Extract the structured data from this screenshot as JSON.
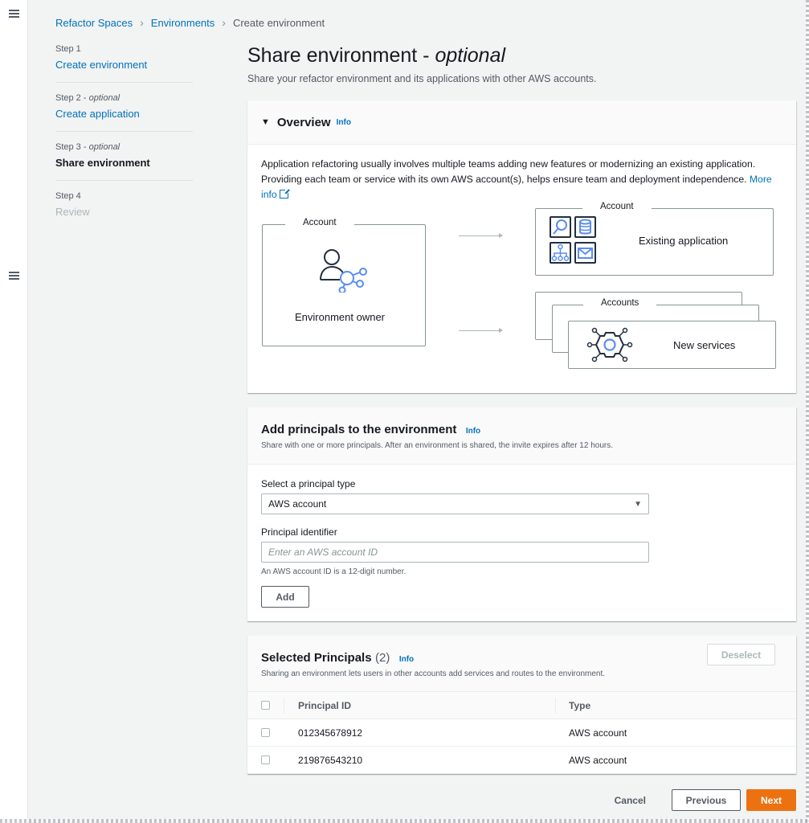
{
  "breadcrumb": [
    {
      "label": "Refactor Spaces",
      "link": true
    },
    {
      "label": "Environments",
      "link": true
    },
    {
      "label": "Create environment",
      "link": false
    }
  ],
  "steps": [
    {
      "number": "Step 1",
      "optional": "",
      "title": "Create environment",
      "state": "link"
    },
    {
      "number": "Step 2",
      "optional": "optional",
      "title": "Create application",
      "state": "link"
    },
    {
      "number": "Step 3",
      "optional": "optional",
      "title": "Share environment",
      "state": "active"
    },
    {
      "number": "Step 4",
      "optional": "",
      "title": "Review",
      "state": "disabled"
    }
  ],
  "page": {
    "title": "Share environment - ",
    "title_optional": "optional",
    "subtitle": "Share your refactor environment and its applications with other AWS accounts."
  },
  "overview": {
    "title": "Overview",
    "info": "Info",
    "text": "Application refactoring usually involves multiple teams adding new features or modernizing an existing application. Providing each team or service with its own AWS account(s), helps ensure team and deployment independence. ",
    "more_info": "More info",
    "diagram": {
      "owner_label": "Account",
      "owner_text": "Environment owner",
      "existing_label": "Account",
      "existing_text": "Existing application",
      "services_label": "Accounts",
      "services_text": "New services"
    }
  },
  "add_principals": {
    "title": "Add principals to the environment",
    "info": "Info",
    "description": "Share with one or more principals. After an environment is shared, the invite expires after 12 hours.",
    "type_label": "Select a principal type",
    "type_value": "AWS account",
    "identifier_label": "Principal identifier",
    "identifier_placeholder": "Enter an AWS account ID",
    "identifier_value": "",
    "hint": "An AWS account ID is a 12-digit number.",
    "add_button": "Add"
  },
  "selected_principals": {
    "title": "Selected Principals",
    "count": "(2)",
    "info": "Info",
    "description": "Sharing an environment lets users in other accounts add services and routes to the environment.",
    "deselect_button": "Deselect",
    "columns": [
      "Principal ID",
      "Type"
    ],
    "rows": [
      {
        "id": "012345678912",
        "type": "AWS account"
      },
      {
        "id": "219876543210",
        "type": "AWS account"
      }
    ]
  },
  "footer": {
    "cancel": "Cancel",
    "previous": "Previous",
    "next": "Next"
  },
  "colors": {
    "primary": "#ec7211",
    "link": "#0073bb",
    "diagram_accent": "#5a8df0"
  }
}
